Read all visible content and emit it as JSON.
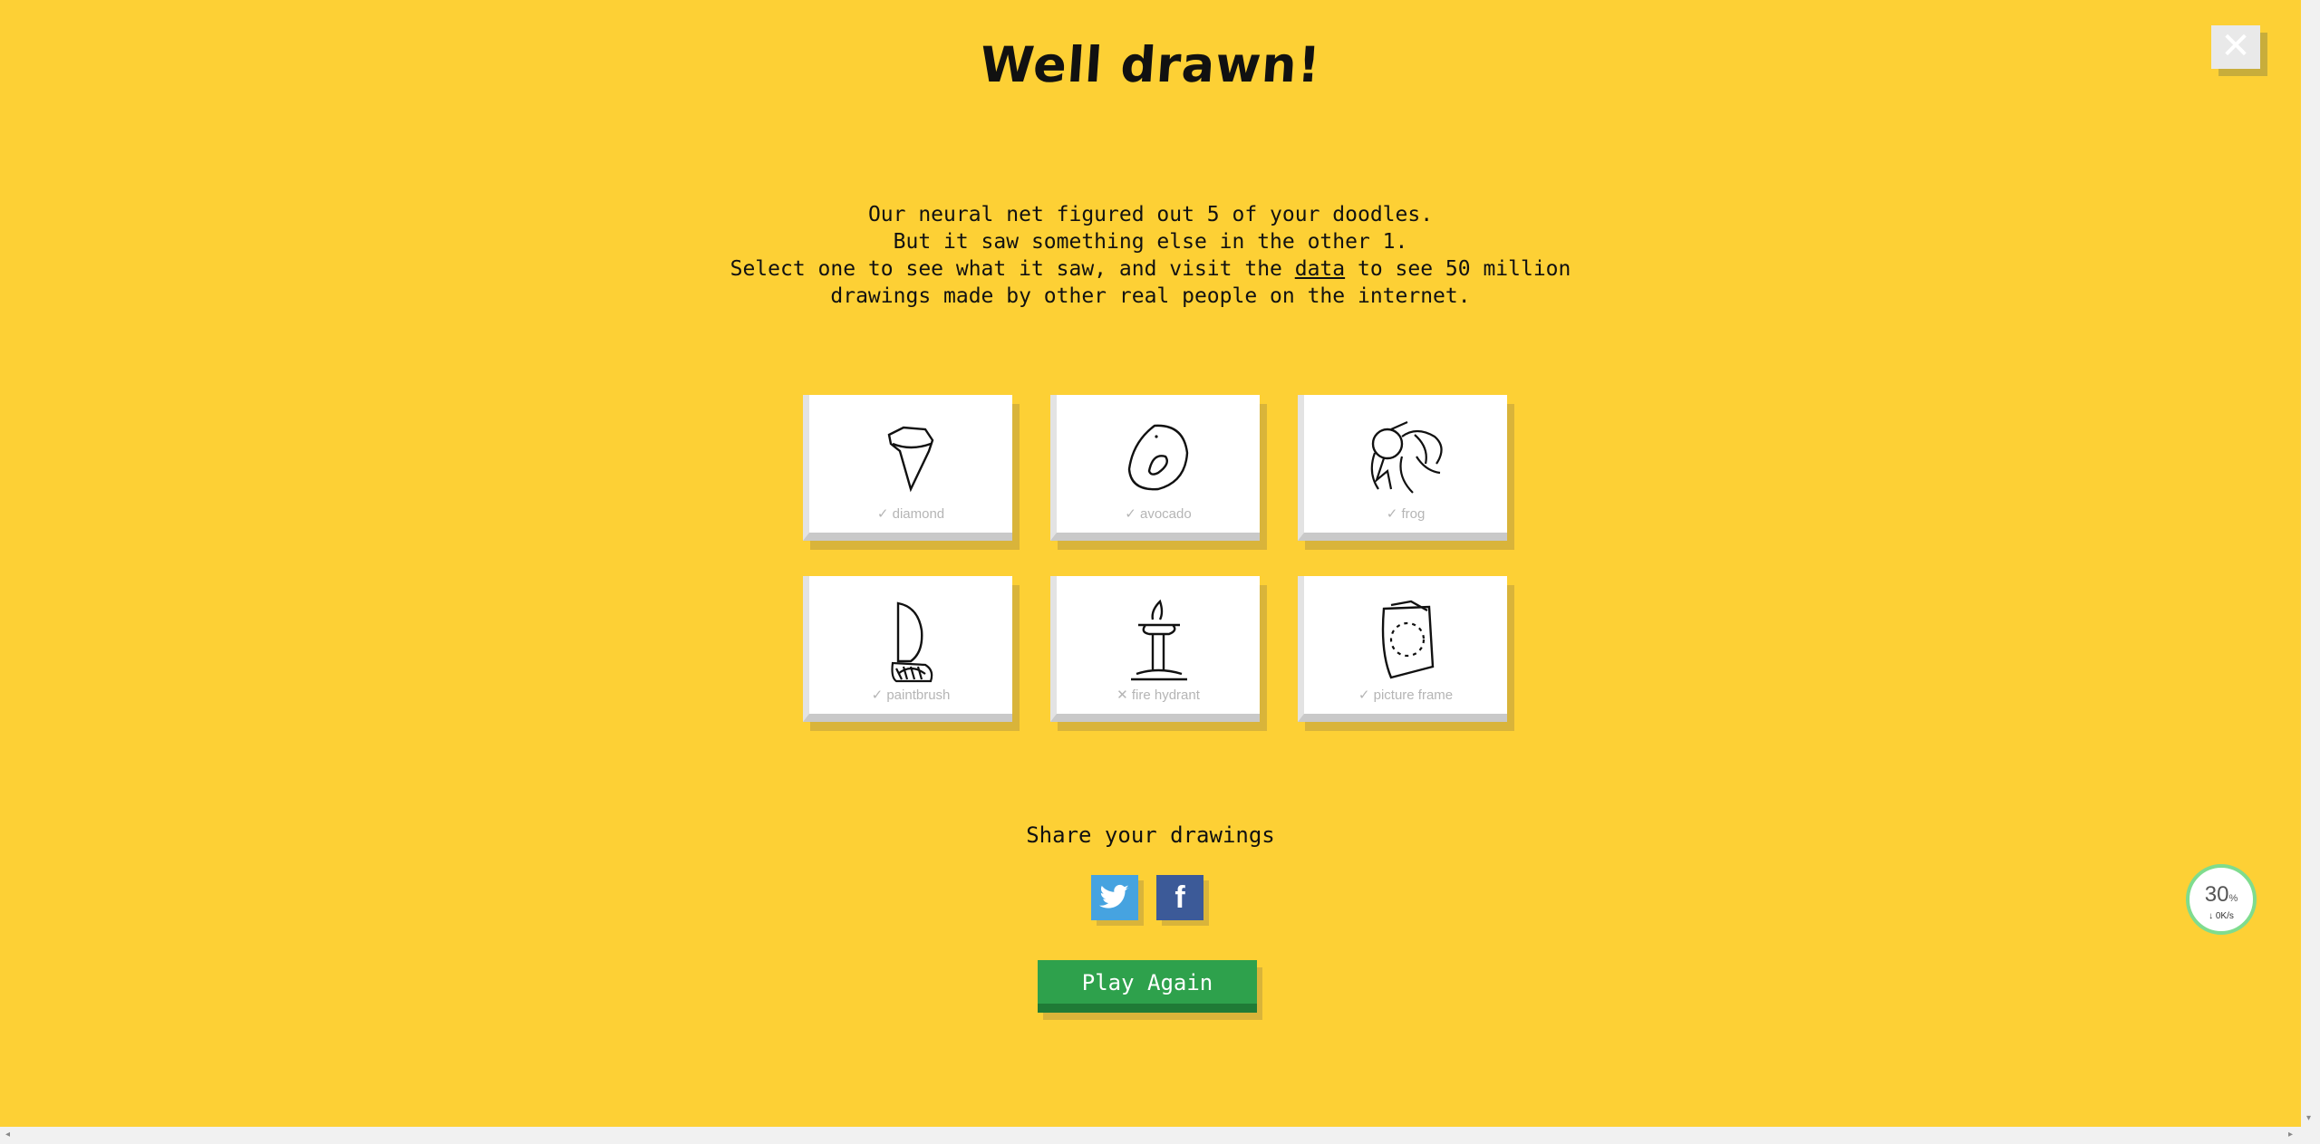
{
  "title": "Well drawn!",
  "close": {
    "label": "✕"
  },
  "message": {
    "line1": "Our neural net figured out 5 of your doodles.",
    "line2": "But it saw something else in the other 1.",
    "line3_before": "Select one to see what it saw, and visit the ",
    "line3_link": "data",
    "line3_after": " to see 50 million",
    "line4": "drawings made by other real people on the internet."
  },
  "doodles": [
    {
      "label": "✓ diamond",
      "correct": true
    },
    {
      "label": "✓ avocado",
      "correct": true
    },
    {
      "label": "✓ frog",
      "correct": true
    },
    {
      "label": "✓ paintbrush",
      "correct": true
    },
    {
      "label": "✕ fire hydrant",
      "correct": false
    },
    {
      "label": "✓ picture frame",
      "correct": true
    }
  ],
  "share": {
    "title": "Share your drawings",
    "twitter_icon": "twitter-icon",
    "facebook_icon": "facebook-icon",
    "facebook_glyph": "f"
  },
  "play_again": "Play Again",
  "speed_widget": {
    "percent": "30",
    "unit": "%",
    "rate": "↓ 0K/s"
  },
  "scrollbar": {
    "left_arrow": "◂",
    "right_arrow": "▸",
    "down_arrow": "▾"
  }
}
